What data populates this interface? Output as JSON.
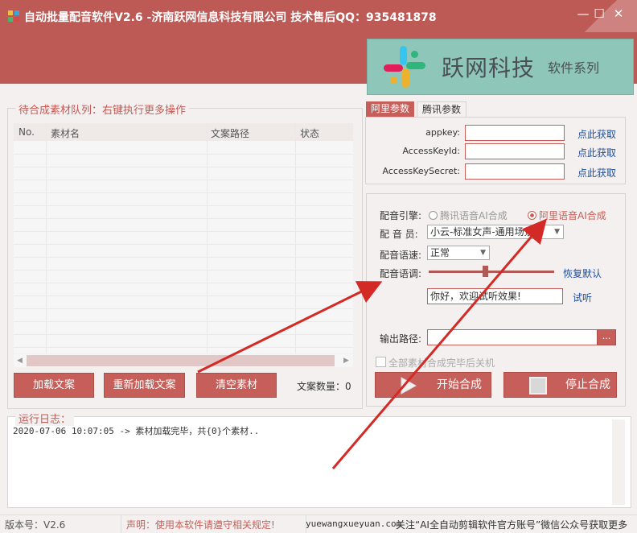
{
  "window": {
    "title": "自动批量配音软件V2.6 -济南跃网信息科技有限公司 技术售后QQ：935481878",
    "minimize": "—",
    "maximize": "☐",
    "close": "✕",
    "icon": "app-logo-icon"
  },
  "banner": {
    "brand": "跃网科技",
    "series": "软件系列"
  },
  "queue": {
    "legend": "待合成素材队列：右键执行更多操作",
    "columns": [
      "No.",
      "素材名",
      "文案路径",
      "状态"
    ],
    "rows": []
  },
  "buttons": {
    "load": "加载文案",
    "reload": "重新加载文案",
    "clear": "清空素材",
    "count_label": "文案数量：",
    "count_value": "0",
    "start": "开始合成",
    "stop": "停止合成"
  },
  "tabs": {
    "aliyun": "阿里参数",
    "tencent": "腾讯参数",
    "active": "aliyun"
  },
  "keys": [
    {
      "label": "appkey:",
      "value": "",
      "link": "点此获取"
    },
    {
      "label": "AccessKeyId:",
      "value": "",
      "link": "点此获取"
    },
    {
      "label": "AccessKeySecret:",
      "value": "",
      "link": "点此获取"
    }
  ],
  "dub": {
    "engine_label": "配音引擎:",
    "engine_opt1": "腾讯语音AI合成",
    "engine_opt2": "阿里语音AI合成",
    "engine_selected": "阿里语音AI合成",
    "voice_label": "配 音 员:",
    "voice_value": "小云-标准女声-通用场景",
    "speed_label": "配音语速:",
    "speed_value": "正常",
    "pitch_label": "配音语调:",
    "pitch_level": 0.45,
    "reset": "恢复默认",
    "test_text": "你好，欢迎试听效果!",
    "test_link": "试听",
    "output_label": "输出路径:",
    "output_value": "",
    "browse": "...",
    "shutdown": "全部素材合成完毕后关机"
  },
  "log": {
    "legend": "运行日志：",
    "lines": [
      "2020-07-06 10:07:05 -> 素材加载完毕，共{0}个素材.."
    ]
  },
  "status": {
    "version": "版本号：V2.6",
    "notice": "声明：使用本软件请遵守相关规定!",
    "url": "yuewangxueyuan.com",
    "wechat": "关注“AI全自动剪辑软件官方账号”微信公众号获取更多"
  },
  "colors": {
    "accent": "#c65f59",
    "titlebar": "#bd5a56",
    "link": "#1f4d9c",
    "annotation": "#d32a26"
  }
}
